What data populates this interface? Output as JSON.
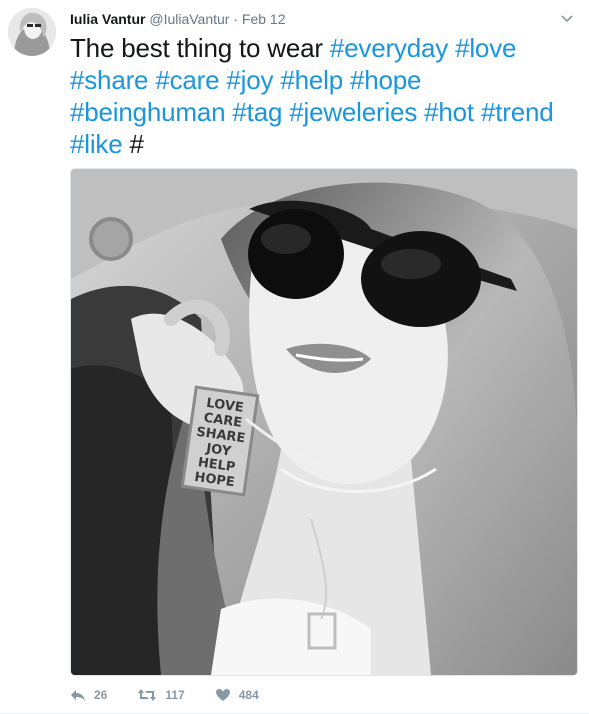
{
  "tweet": {
    "author_name": "Iulia Vantur",
    "handle": "@IuliaVantur",
    "separator": "·",
    "date": "Feb 12",
    "text_plain": "The best thing to wear ",
    "hashtags": [
      "#everyday",
      "#love",
      "#share",
      "#care",
      "#joy",
      "#help",
      "#hope",
      "#beinghuman",
      "#tag",
      "#jeweleries",
      "#hot",
      "#trend",
      "#like",
      "#"
    ]
  },
  "pendant_words": [
    "LOVE",
    "CARE",
    "SHARE",
    "JOY",
    "HELP",
    "HOPE"
  ],
  "actions": {
    "reply_count": "26",
    "retweet_count": "117",
    "like_count": "484"
  },
  "colors": {
    "hashtag": "#1b95e0",
    "meta": "#657786",
    "action": "#8899a6"
  }
}
